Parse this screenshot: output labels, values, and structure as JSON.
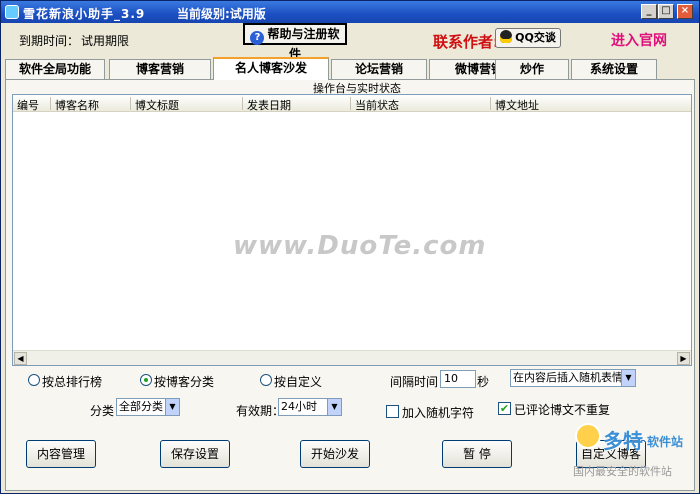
{
  "window": {
    "title": "雪花新浪小助手_3.9",
    "level_text": "当前级别:试用版",
    "min_label": "_",
    "max_label": "□",
    "close_label": "×"
  },
  "header": {
    "expire_label": "到期时间：",
    "expire_value": "试用期限",
    "help_button": "帮助与注册软件",
    "contact_author": "联系作者:",
    "qq_button": "QQ交谈",
    "official_site": "进入官网"
  },
  "tabs": [
    {
      "label": "软件全局功能",
      "active": false
    },
    {
      "label": "博客营销",
      "active": false
    },
    {
      "label": "名人博客沙发",
      "active": true
    },
    {
      "label": "论坛营销",
      "active": false
    },
    {
      "label": "微博营销",
      "active": false
    },
    {
      "label": "炒作",
      "active": false
    },
    {
      "label": "系统设置",
      "active": false
    }
  ],
  "panel": {
    "group_title": "操作台与实时状态",
    "columns": [
      "编号",
      "博客名称",
      "博文标题",
      "发表日期",
      "当前状态",
      "博文地址"
    ],
    "rows": [],
    "watermark": "www.DuoTe.com"
  },
  "options": {
    "radio_total": "按总排行榜",
    "radio_category": "按博客分类",
    "radio_custom": "按自定义",
    "selected_radio": "按博客分类",
    "interval_label": "间隔时间：",
    "interval_value": "10",
    "interval_unit": "秒",
    "insert_option": "在内容后插入随机表情",
    "category_label": "分类：",
    "category_value": "全部分类",
    "valid_label": "有效期：",
    "valid_value": "24小时",
    "random_char_label": "加入随机字符",
    "random_char_checked": false,
    "no_repeat_label": "已评论博文不重复",
    "no_repeat_checked": true
  },
  "buttons": {
    "content_manage": "内容管理",
    "save_settings": "保存设置",
    "start_sofa": "开始沙发",
    "pause": "暂 停",
    "custom_blog": "自定义博客"
  },
  "site_logo": {
    "name": "多特",
    "suffix": "软件站",
    "tagline": "国内最安全的软件站"
  }
}
